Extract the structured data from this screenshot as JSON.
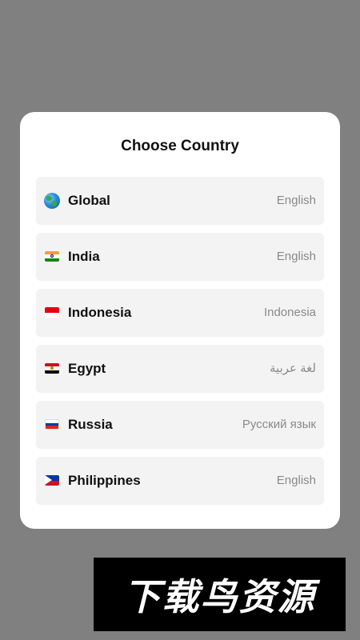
{
  "dialog": {
    "title": "Choose Country",
    "countries": [
      {
        "name": "Global",
        "language": "English",
        "flag_icon": "globe-icon"
      },
      {
        "name": "India",
        "language": "English",
        "flag_icon": "india-flag-icon",
        "flag_colors": [
          "#ff9933",
          "#ffffff",
          "#138808"
        ]
      },
      {
        "name": "Indonesia",
        "language": "Indonesia",
        "flag_icon": "indonesia-flag-icon",
        "flag_colors": [
          "#e70011",
          "#ffffff"
        ]
      },
      {
        "name": "Egypt",
        "language": "لغة عربية",
        "flag_icon": "egypt-flag-icon",
        "flag_colors": [
          "#ce1126",
          "#ffffff",
          "#000000"
        ]
      },
      {
        "name": "Russia",
        "language": "Русский язык",
        "flag_icon": "russia-flag-icon",
        "flag_colors": [
          "#ffffff",
          "#0039a6",
          "#d52b1e"
        ]
      },
      {
        "name": "Philippines",
        "language": "English",
        "flag_icon": "philippines-flag-icon",
        "flag_colors": [
          "#0038a8",
          "#ce1126"
        ]
      }
    ]
  },
  "watermark": {
    "text": "下载鸟资源"
  }
}
